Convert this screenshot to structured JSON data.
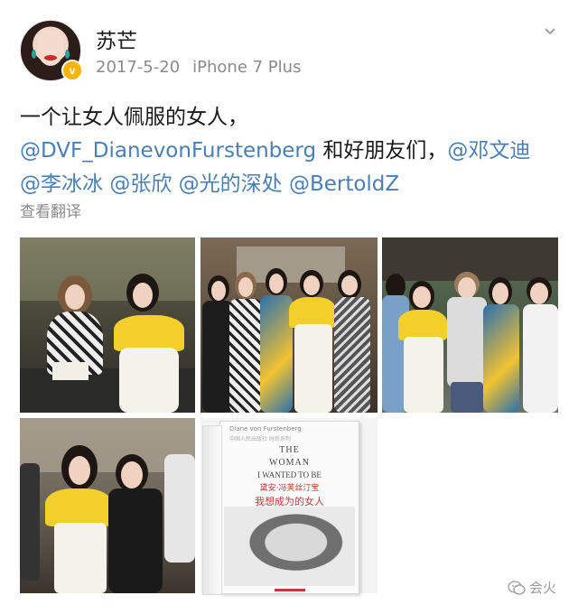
{
  "post": {
    "username": "苏芒",
    "date": "2017-5-20",
    "device": "iPhone 7 Plus",
    "verified_badge": "v",
    "line1": "一个让女人佩服的女人，",
    "line2_mention1": "@DVF_DianevonFurstenberg",
    "line2_text": " 和好朋友们，",
    "line2_mention2": "@邓文迪",
    "line3_mention1": "@李冰冰",
    "line3_mention2": "@张欣",
    "line3_mention3": "@光的深处",
    "line3_mention4": "@BertoldZ",
    "translate_label": "查看翻译"
  },
  "book": {
    "author": "Diane von Furstenberg",
    "series": "中国人民出版社 时尚系列",
    "title_en_1": "THE",
    "title_en_2": "WOMAN",
    "title_en_3": "I WANTED TO BE",
    "title_cn_author": "黛安·冯芙丝汀宝",
    "title_cn": "我想成为的女人"
  },
  "watermark": {
    "text": "会火"
  },
  "colors": {
    "mention": "#4a7fb5",
    "meta": "#8a8a8a",
    "badge": "#f7b500"
  },
  "icons": {
    "more": "chevron-down-icon",
    "verified": "verified-badge-icon",
    "watermark": "wechat-icon"
  }
}
